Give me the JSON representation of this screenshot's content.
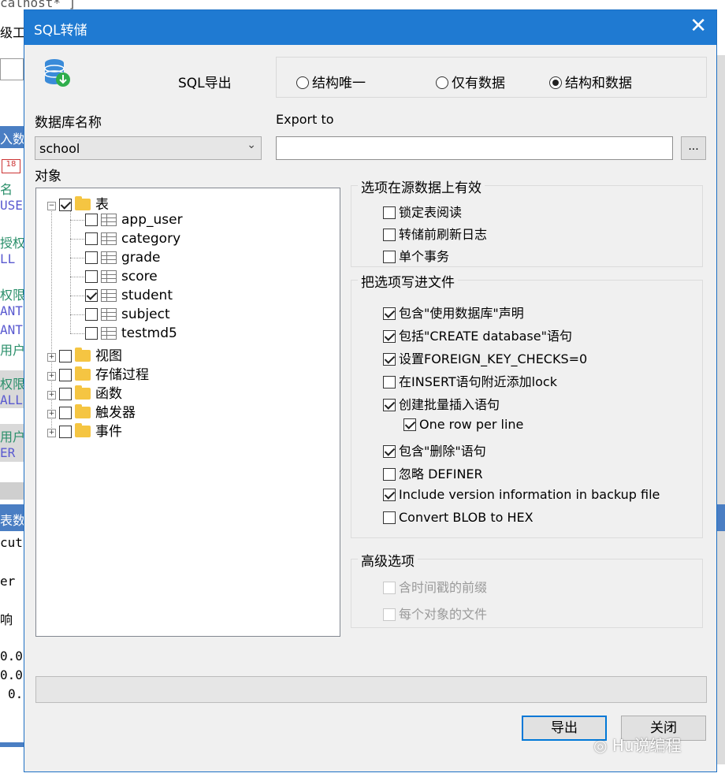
{
  "background": {
    "top_tab": "calhost* ]",
    "top_text": "级工",
    "left_fragments": [
      "入数",
      "名",
      "USE",
      "授权",
      "LL",
      "权限",
      "ANT",
      "ANT",
      "用户",
      "权限",
      "ALL",
      "用户",
      "ER",
      "表数",
      "cut",
      "er",
      "响",
      "0.0",
      "0.0",
      "0."
    ]
  },
  "dialog": {
    "title": "SQL转储",
    "close_glyph": "✕",
    "icon": "database-export-icon",
    "export_label": "SQL导出",
    "radios": [
      {
        "label": "结构唯一",
        "checked": false
      },
      {
        "label": "仅有数据",
        "checked": false
      },
      {
        "label": "结构和数据",
        "checked": true
      }
    ],
    "db_label": "数据库名称",
    "db_value": "school",
    "export_to_label": "Export to",
    "export_to_value": "",
    "browse_label": "...",
    "objects_label": "对象",
    "tree": {
      "tables_label": "表",
      "tables": [
        {
          "name": "app_user",
          "checked": false
        },
        {
          "name": "category",
          "checked": false
        },
        {
          "name": "grade",
          "checked": false
        },
        {
          "name": "score",
          "checked": false
        },
        {
          "name": "student",
          "checked": true
        },
        {
          "name": "subject",
          "checked": false
        },
        {
          "name": "testmd5",
          "checked": false
        }
      ],
      "others": [
        "视图",
        "存储过程",
        "函数",
        "触发器",
        "事件"
      ]
    },
    "group_source": {
      "caption": "选项在源数据上有效",
      "options": [
        {
          "label": "锁定表阅读",
          "checked": false
        },
        {
          "label": "转储前刷新日志",
          "checked": false
        },
        {
          "label": "单个事务",
          "checked": false
        }
      ]
    },
    "group_file": {
      "caption": "把选项写进文件",
      "options": [
        {
          "label": "包含\"使用数据库\"声明",
          "checked": true
        },
        {
          "label": "包括\"CREATE database\"语句",
          "checked": true
        },
        {
          "label": "设置FOREIGN_KEY_CHECKS=0",
          "checked": true
        },
        {
          "label": "在INSERT语句附近添加lock",
          "checked": false
        },
        {
          "label": "创建批量插入语句",
          "checked": true
        },
        {
          "label": "One row per line",
          "checked": true
        },
        {
          "label": "包含\"删除\"语句",
          "checked": true
        },
        {
          "label": "忽略 DEFINER",
          "checked": false
        },
        {
          "label": "Include version information in backup file",
          "checked": true
        },
        {
          "label": "Convert BLOB to HEX",
          "checked": false
        }
      ]
    },
    "group_adv": {
      "caption": "高级选项",
      "options": [
        {
          "label": "含时间戳的前缀",
          "checked": false
        },
        {
          "label": "每个对象的文件",
          "checked": false
        }
      ]
    },
    "ok_label": "导出",
    "close_label": "关闭",
    "watermark": "Hu说编程"
  }
}
